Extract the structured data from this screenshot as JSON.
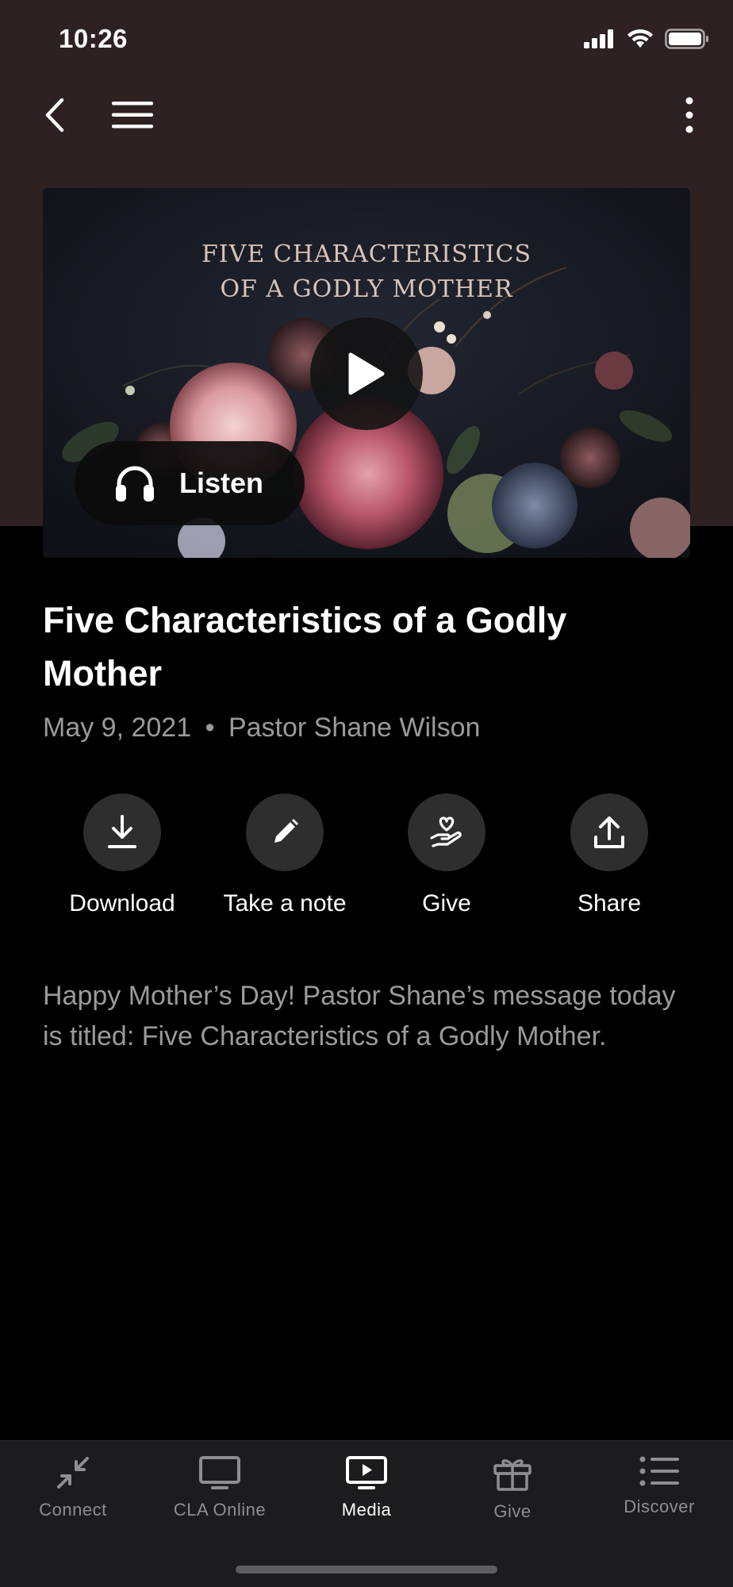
{
  "status": {
    "time": "10:26"
  },
  "hero": {
    "title_line1": "FIVE CHARACTERISTICS",
    "title_line2": "OF A GODLY MOTHER",
    "listen_label": "Listen"
  },
  "sermon": {
    "title": "Five Characteristics of a Godly Mother",
    "date": "May 9, 2021",
    "separator": "•",
    "speaker": "Pastor Shane Wilson",
    "description": "Happy Mother’s Day! Pastor Shane’s message today is titled: Five Characteristics of a Godly Mother."
  },
  "actions": [
    {
      "label": "Download",
      "icon": "download-icon"
    },
    {
      "label": "Take a note",
      "icon": "pencil-icon"
    },
    {
      "label": "Give",
      "icon": "hand-heart-icon"
    },
    {
      "label": "Share",
      "icon": "share-icon"
    }
  ],
  "tabs": [
    {
      "label": "Connect",
      "icon": "connect-icon",
      "active": false
    },
    {
      "label": "CLA Online",
      "icon": "monitor-icon",
      "active": false
    },
    {
      "label": "Media",
      "icon": "play-screen-icon",
      "active": true
    },
    {
      "label": "Give",
      "icon": "gift-icon",
      "active": false
    },
    {
      "label": "Discover",
      "icon": "list-icon",
      "active": false
    }
  ],
  "colors": {
    "header_bg": "#2e2121",
    "background": "#000000",
    "tab_active": "#ffffff",
    "tab_inactive": "#8e8e93"
  }
}
